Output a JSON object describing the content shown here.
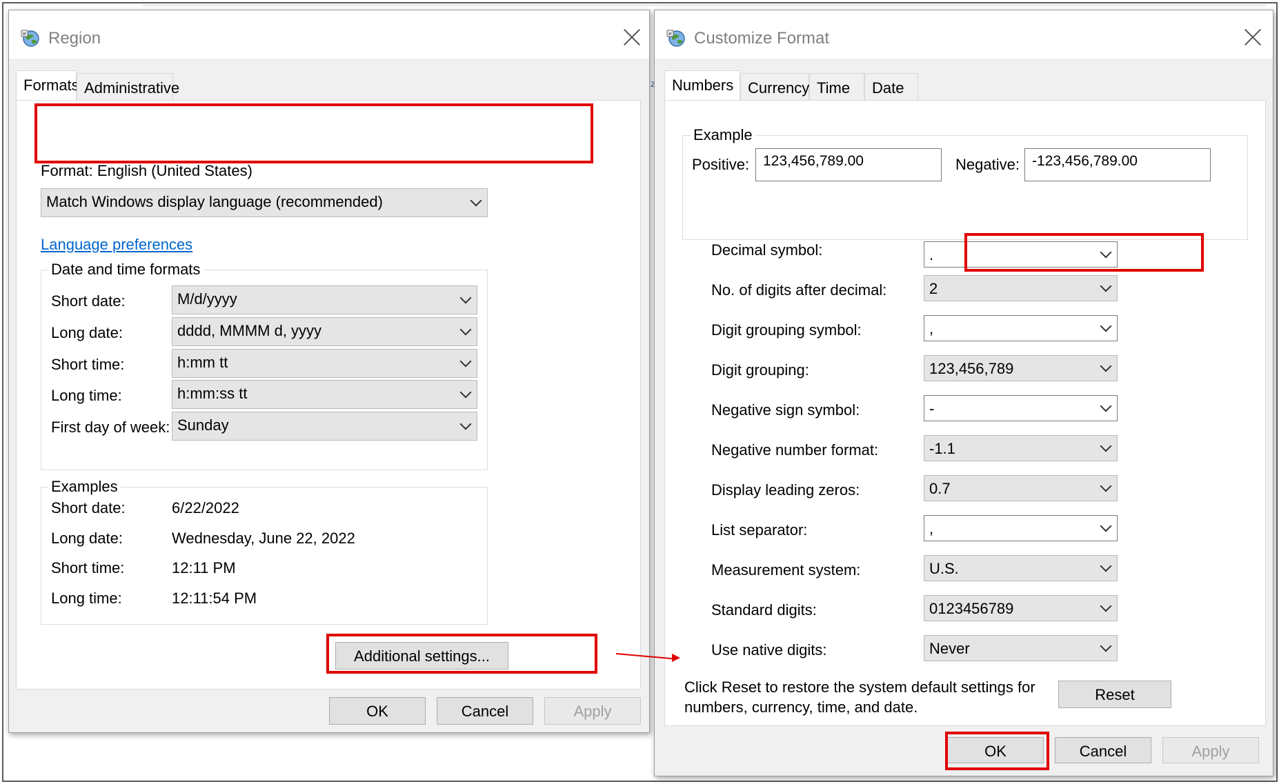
{
  "region": {
    "title": "Region",
    "tabs": [
      "Formats",
      "Administrative"
    ],
    "format_label": "Format: English (United States)",
    "format_value": "Match Windows display language (recommended)",
    "language_link": "Language preferences",
    "datetime_group": "Date and time formats",
    "datetime_rows": [
      {
        "label": "Short date:",
        "value": "M/d/yyyy"
      },
      {
        "label": "Long date:",
        "value": "dddd, MMMM d, yyyy"
      },
      {
        "label": "Short time:",
        "value": "h:mm tt"
      },
      {
        "label": "Long time:",
        "value": "h:mm:ss tt"
      },
      {
        "label": "First day of week:",
        "value": "Sunday"
      }
    ],
    "examples_group": "Examples",
    "examples_rows": [
      {
        "label": "Short date:",
        "value": "6/22/2022"
      },
      {
        "label": "Long date:",
        "value": "Wednesday, June 22, 2022"
      },
      {
        "label": "Short time:",
        "value": "12:11 PM"
      },
      {
        "label": "Long time:",
        "value": "12:11:54 PM"
      }
    ],
    "additional_settings": "Additional settings...",
    "ok": "OK",
    "cancel": "Cancel",
    "apply": "Apply"
  },
  "customize": {
    "title": "Customize Format",
    "tabs": [
      "Numbers",
      "Currency",
      "Time",
      "Date"
    ],
    "example_group": "Example",
    "positive_label": "Positive:",
    "positive_value": "123,456,789.00",
    "negative_label": "Negative:",
    "negative_value": "-123,456,789.00",
    "settings": [
      {
        "label": "Decimal symbol:",
        "value": "."
      },
      {
        "label": "No. of digits after decimal:",
        "value": "2"
      },
      {
        "label": "Digit grouping symbol:",
        "value": ","
      },
      {
        "label": "Digit grouping:",
        "value": "123,456,789"
      },
      {
        "label": "Negative sign symbol:",
        "value": "-"
      },
      {
        "label": "Negative number format:",
        "value": "-1.1"
      },
      {
        "label": "Display leading zeros:",
        "value": "0.7"
      },
      {
        "label": "List separator:",
        "value": ","
      },
      {
        "label": "Measurement system:",
        "value": "U.S."
      },
      {
        "label": "Standard digits:",
        "value": "0123456789"
      },
      {
        "label": "Use native digits:",
        "value": "Never"
      }
    ],
    "reset_text_line1": "Click Reset to restore the system default settings for",
    "reset_text_line2": "numbers, currency, time, and date.",
    "reset": "Reset",
    "ok": "OK",
    "cancel": "Cancel",
    "apply": "Apply"
  },
  "colors": {
    "highlight": "#e00000",
    "link": "#0066cc",
    "disabled_text": "#a0a0a0"
  }
}
